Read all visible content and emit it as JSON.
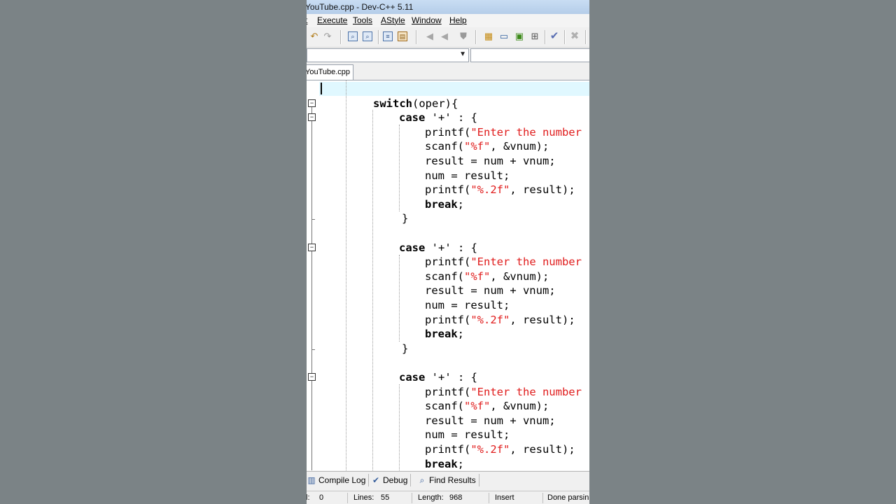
{
  "window": {
    "title": "YouTube.cpp - Dev-C++ 5.11"
  },
  "menu": [
    "t",
    "Execute",
    "Tools",
    "AStyle",
    "Window",
    "Help"
  ],
  "toolbar_icons": [
    "undo-icon",
    "redo-icon",
    "find-icon",
    "replace-icon",
    "compile-icon",
    "run-icon",
    "indent-icon",
    "unindent-icon",
    "bookmark-icon",
    "new-project-icon",
    "window-icon",
    "toggle-icon",
    "grid-icon",
    "check-icon",
    "close-icon"
  ],
  "editor": {
    "tab_label": "YouTube.cpp",
    "lines": [
      [],
      [
        {
          "t": "switch",
          "c": "kw"
        },
        {
          "t": "(oper){"
        }
      ],
      [
        {
          "t": "case",
          "c": "kw"
        },
        {
          "t": " '+' : {"
        }
      ],
      [
        {
          "t": "printf("
        },
        {
          "t": "\"Enter the number",
          "c": "str"
        }
      ],
      [
        {
          "t": "scanf("
        },
        {
          "t": "\"%f\"",
          "c": "str"
        },
        {
          "t": ", &vnum);"
        }
      ],
      [
        {
          "t": "result = num + vnum;"
        }
      ],
      [
        {
          "t": "num = result;"
        }
      ],
      [
        {
          "t": "printf("
        },
        {
          "t": "\"%.2f\"",
          "c": "str"
        },
        {
          "t": ", result);"
        }
      ],
      [
        {
          "t": "break",
          "c": "kw"
        },
        {
          "t": ";"
        }
      ],
      [
        {
          "t": "}"
        }
      ],
      [],
      [
        {
          "t": "case",
          "c": "kw"
        },
        {
          "t": " '+' : {"
        }
      ],
      [
        {
          "t": "printf("
        },
        {
          "t": "\"Enter the number",
          "c": "str"
        }
      ],
      [
        {
          "t": "scanf("
        },
        {
          "t": "\"%f\"",
          "c": "str"
        },
        {
          "t": ", &vnum);"
        }
      ],
      [
        {
          "t": "result = num + vnum;"
        }
      ],
      [
        {
          "t": "num = result;"
        }
      ],
      [
        {
          "t": "printf("
        },
        {
          "t": "\"%.2f\"",
          "c": "str"
        },
        {
          "t": ", result);"
        }
      ],
      [
        {
          "t": "break",
          "c": "kw"
        },
        {
          "t": ";"
        }
      ],
      [
        {
          "t": "}"
        }
      ],
      [],
      [
        {
          "t": "case",
          "c": "kw"
        },
        {
          "t": " '+' : {"
        }
      ],
      [
        {
          "t": "printf("
        },
        {
          "t": "\"Enter the number",
          "c": "str"
        }
      ],
      [
        {
          "t": "scanf("
        },
        {
          "t": "\"%f\"",
          "c": "str"
        },
        {
          "t": ", &vnum);"
        }
      ],
      [
        {
          "t": "result = num + vnum;"
        }
      ],
      [
        {
          "t": "num = result;"
        }
      ],
      [
        {
          "t": "printf("
        },
        {
          "t": "\"%.2f\"",
          "c": "str"
        },
        {
          "t": ", result);"
        }
      ],
      [
        {
          "t": "break",
          "c": "kw"
        },
        {
          "t": ";"
        }
      ]
    ]
  },
  "bottom_tabs": {
    "compile_log": "Compile Log",
    "debug": "Debug",
    "find_results": "Find Results"
  },
  "status": {
    "col_label": "l:",
    "col_value": "0",
    "lines_label": "Lines:",
    "lines_value": "55",
    "length_label": "Length:",
    "length_value": "968",
    "mode": "Insert",
    "message": "Done parsin"
  },
  "colors": {
    "keyword": "#000000",
    "string": "#e01c1c",
    "current_line": "#e0f8ff",
    "background": "#7b8386"
  }
}
